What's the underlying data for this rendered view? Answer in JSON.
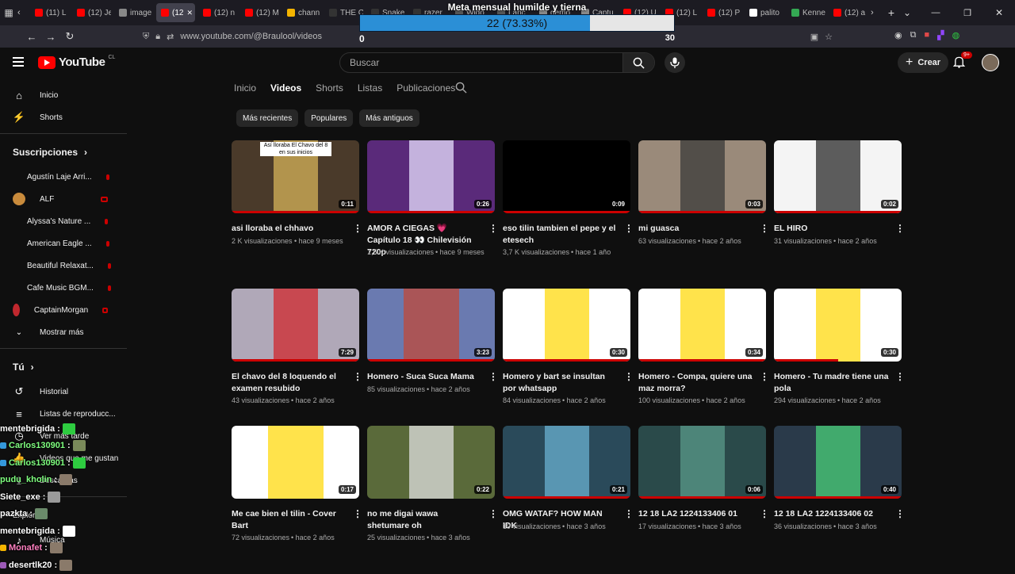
{
  "browser": {
    "tabs": [
      {
        "label": "(11) L",
        "color": "#ff0000"
      },
      {
        "label": "(12) Je",
        "color": "#ff0000"
      },
      {
        "label": "image",
        "color": "#888888"
      },
      {
        "label": "(12",
        "color": "#ff0000",
        "active": true
      },
      {
        "label": "(12) n",
        "color": "#ff0000"
      },
      {
        "label": "(12) M",
        "color": "#ff0000"
      },
      {
        "label": "chann",
        "color": "#f4b400"
      },
      {
        "label": "THE C",
        "color": "#333333"
      },
      {
        "label": "Snake",
        "color": "#333333"
      },
      {
        "label": "razer",
        "color": "#333333"
      },
      {
        "label": "Wido",
        "color": "#555555"
      },
      {
        "label": "Lanc",
        "color": "#555555"
      },
      {
        "label": "demo",
        "color": "#888888"
      },
      {
        "label": "Captu",
        "color": "#888888"
      },
      {
        "label": "(12) U",
        "color": "#ff0000"
      },
      {
        "label": "(12) L",
        "color": "#ff0000"
      },
      {
        "label": "(12) P",
        "color": "#ff0000"
      },
      {
        "label": "palito",
        "color": "#ffffff"
      },
      {
        "label": "Kenne",
        "color": "#34a853"
      },
      {
        "label": "(12) a",
        "color": "#ff0000"
      }
    ],
    "url": "www.youtube.com/@Braulool/videos",
    "new_tab": "+",
    "tabs_menu": "⌄"
  },
  "goal": {
    "title": "Meta mensual humilde y tierna",
    "current_text": "22 (73.33%)",
    "progress": 0.7333,
    "min": "0",
    "max": "30",
    "fill_color": "#2b8fd6"
  },
  "header": {
    "logo_text": "YouTube",
    "logo_country": "CL",
    "search_placeholder": "Buscar",
    "create_label": "Crear",
    "notifications_badge": "9+",
    "brand_color": "#ff0000"
  },
  "sidebar": {
    "main": [
      {
        "label": "Inicio",
        "icon": "⌂"
      },
      {
        "label": "Shorts",
        "icon": "⚡"
      }
    ],
    "subscriptions_title": "Suscripciones",
    "subscriptions": [
      {
        "label": "Agustín Laje Arri...",
        "color": "#7a3b2e"
      },
      {
        "label": "ALF",
        "color": "#c98b3c"
      },
      {
        "label": "Alyssa's Nature ...",
        "color": "#d8d8c0"
      },
      {
        "label": "American Eagle ...",
        "color": "#444444"
      },
      {
        "label": "Beautiful Relaxat...",
        "color": "#2b5d8a"
      },
      {
        "label": "Cafe Music BGM...",
        "color": "#3b3b3b"
      },
      {
        "label": "CaptainMorgan",
        "color": "#c0282e"
      }
    ],
    "show_more": "Mostrar más",
    "you_title": "Tú",
    "you_items": [
      {
        "label": "Historial",
        "icon": "↺"
      },
      {
        "label": "Listas de reproducc...",
        "icon": "≡"
      },
      {
        "label": "Ver más tarde",
        "icon": "◷"
      },
      {
        "label": "Videos que me gustan",
        "icon": "👍"
      },
      {
        "label": "Descargas",
        "icon": "⤓"
      }
    ],
    "explore_title": "Explorar",
    "explore_items": [
      {
        "label": "Música",
        "icon": "♪"
      }
    ]
  },
  "chat": [
    {
      "user": "mentebrigida",
      "color": "#ffffff",
      "text": ":",
      "badge": "",
      "emote": "#2ecc40"
    },
    {
      "user": "Carlos130901",
      "color": "#7fff7f",
      "text": ":",
      "badge": "#3498db",
      "emote": "#7a8a5a"
    },
    {
      "user": "Carlos130901",
      "color": "#7fff7f",
      "text": ":",
      "badge": "#3498db",
      "emote": "#2ecc40"
    },
    {
      "user": "pudu_kholin",
      "color": "#7fff7f",
      "text": ":",
      "badge": "",
      "emote": "#8a7a6a"
    },
    {
      "user": "Siete_exe",
      "color": "#ffffff",
      "text": ":",
      "badge": "",
      "emote": "#9a9a9a"
    },
    {
      "user": "pazkta",
      "color": "#ffffff",
      "text": ":",
      "badge": "",
      "emote": "#6a8a6a"
    },
    {
      "user": "mentebrigida",
      "color": "#ffffff",
      "text": ":",
      "badge": "",
      "emote": "#ffffff"
    },
    {
      "user": "Monafet",
      "color": "#ff80c0",
      "text": ":",
      "badge": "#f4b400",
      "emote": "#8a7a6a"
    },
    {
      "user": "desertlk20",
      "color": "#ffffff",
      "text": ":",
      "badge": "#9b59b6",
      "emote": "#8a7a6a"
    }
  ],
  "channel_tabs": [
    {
      "label": "Inicio",
      "active": false
    },
    {
      "label": "Videos",
      "active": true
    },
    {
      "label": "Shorts",
      "active": false
    },
    {
      "label": "Listas",
      "active": false
    },
    {
      "label": "Publicaciones",
      "active": false
    }
  ],
  "chips": [
    "Más recientes",
    "Populares",
    "Más antiguos"
  ],
  "videos": [
    {
      "title": "asi lloraba el chhavo",
      "views": "2 K visualizaciones",
      "age": "hace 9 meses",
      "duration": "0:11",
      "watched": 1.0,
      "thumb_bg": "#4a3a2a",
      "thumb_fg": "#d6b35a",
      "thumb_caption": "Así lloraba El Chavo del 8 en sus inicios"
    },
    {
      "title": "AMOR A CIEGAS 💗 Capítulo 18 👀 Chilevisión 720p",
      "views": "1,5 K visualizaciones",
      "age": "hace 9 meses",
      "duration": "0:26",
      "watched": 1.0,
      "thumb_bg": "#5a2a7a",
      "thumb_fg": "#e8e0ff"
    },
    {
      "title": "eso tilin tambien el pepe y el etesech",
      "views": "3,7 K visualizaciones",
      "age": "hace 1 año",
      "duration": "0:09",
      "watched": 1.0,
      "thumb_bg": "#000000",
      "thumb_fg": "#000000"
    },
    {
      "title": "mi guasca",
      "views": "63 visualizaciones",
      "age": "hace 2 años",
      "duration": "0:03",
      "watched": 1.0,
      "thumb_bg": "#9a8a7a",
      "thumb_fg": "#3a3a3a"
    },
    {
      "title": "EL HIRO",
      "views": "31 visualizaciones",
      "age": "hace 2 años",
      "duration": "0:02",
      "watched": 1.0,
      "thumb_bg": "#f4f4f4",
      "thumb_fg": "#2a2a2a"
    },
    {
      "title": "El chavo del 8 loquendo el examen resubido",
      "views": "43 visualizaciones",
      "age": "hace 2 años",
      "duration": "7:29",
      "watched": 1.0,
      "thumb_bg": "#b0a8b8",
      "thumb_fg": "#d0282e"
    },
    {
      "title": "Homero - Suca Suca Mama",
      "views": "85 visualizaciones",
      "age": "hace 2 años",
      "duration": "3:23",
      "watched": 1.0,
      "thumb_bg": "#6a7ab0",
      "thumb_fg": "#c04a3a",
      "short": true
    },
    {
      "title": "Homero y bart se insultan por whatsapp",
      "views": "84 visualizaciones",
      "age": "hace 2 años",
      "duration": "0:30",
      "watched": 1.0,
      "thumb_bg": "#ffffff",
      "thumb_fg": "#ffd90f"
    },
    {
      "title": "Homero - Compa, quiere una maz morra?",
      "views": "100 visualizaciones",
      "age": "hace 2 años",
      "duration": "0:34",
      "watched": 1.0,
      "thumb_bg": "#ffffff",
      "thumb_fg": "#ffd90f",
      "hover": true
    },
    {
      "title": "Homero - Tu madre tiene una pola",
      "views": "294 visualizaciones",
      "age": "hace 2 años",
      "duration": "0:30",
      "watched": 0.5,
      "thumb_bg": "#ffffff",
      "thumb_fg": "#ffd90f"
    },
    {
      "title": "Me cae bien el tilin - Cover Bart",
      "views": "72 visualizaciones",
      "age": "hace 2 años",
      "duration": "0:17",
      "watched": 0,
      "thumb_bg": "#ffffff",
      "thumb_fg": "#ffd90f",
      "short": true
    },
    {
      "title": "no me digai wawa shetumare oh",
      "views": "25 visualizaciones",
      "age": "hace 3 años",
      "duration": "0:22",
      "watched": 0,
      "thumb_bg": "#5a6a3a",
      "thumb_fg": "#e0e0e0"
    },
    {
      "title": "OMG WATAF? HOW MAN IDK",
      "views": "19 visualizaciones",
      "age": "hace 3 años",
      "duration": "0:21",
      "watched": 1.0,
      "thumb_bg": "#2a4a5a",
      "thumb_fg": "#6ab0d0"
    },
    {
      "title": "12 18 LA2 1224133406 01",
      "views": "17 visualizaciones",
      "age": "hace 3 años",
      "duration": "0:06",
      "watched": 1.0,
      "thumb_bg": "#2a4a4a",
      "thumb_fg": "#5a9a8a"
    },
    {
      "title": "12 18 LA2 1224133406 02",
      "views": "36 visualizaciones",
      "age": "hace 3 años",
      "duration": "0:40",
      "watched": 1.0,
      "thumb_bg": "#2a3a4a",
      "thumb_fg": "#4ad07a"
    }
  ]
}
